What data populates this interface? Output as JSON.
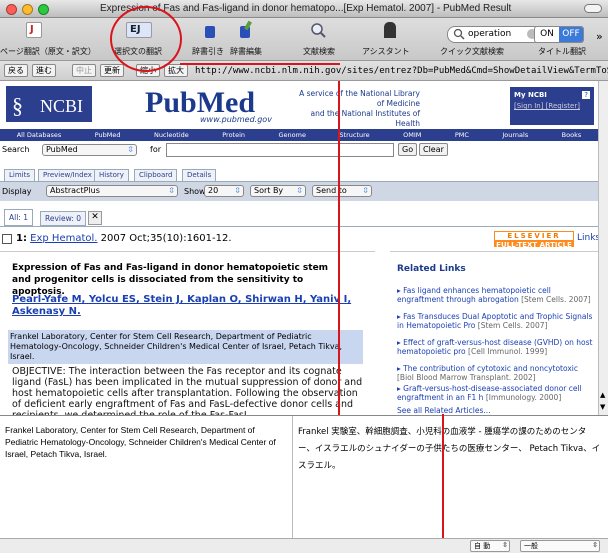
{
  "window": {
    "title": "Expression of Fas and Fas-ligand in donor hematopo...[Exp Hematol. 2007] - PubMed Result"
  },
  "toolbar": {
    "items": [
      {
        "label": "ページ翻訳（原文・訳文）",
        "icon": "page-translate-icon"
      },
      {
        "label": "選択文の翻訳",
        "icon": "selection-translate-icon",
        "icon_text": "EJ"
      },
      {
        "label": "辞書引き",
        "icon": "dictionary-lookup-icon"
      },
      {
        "label": "辞書編集",
        "icon": "dictionary-edit-icon"
      },
      {
        "label": "文献検索",
        "icon": "literature-search-icon"
      },
      {
        "label": "アシスタント",
        "icon": "assistant-icon"
      },
      {
        "label": "クイック文献検索",
        "icon": "quick-search-icon"
      },
      {
        "label": "タイトル翻訳",
        "icon": "title-translate-icon"
      }
    ],
    "search_value": "operation",
    "toggle_on": "ON",
    "toggle_off": "OFF",
    "more": "»"
  },
  "navbar": {
    "back": "戻る",
    "forward": "進む",
    "stop": "中止",
    "reload": "更新",
    "zoom_out": "縮小",
    "zoom_in": "拡大",
    "url": "http://www.ncbi.nlm.nih.gov/sites/entrez?Db=PubMed&Cmd=ShowDetailView&TermToSearch=17"
  },
  "banner": {
    "ncbi": "NCBI",
    "pubmed": "PubMed",
    "pubmed_sub": "www.pubmed.gov",
    "nlm_line1": "A service of the National Library of Medicine",
    "nlm_line2": "and the National Institutes of Health",
    "myncbi": "My NCBI",
    "myncbi_help": "?",
    "signin": "[Sign In] [Register]"
  },
  "dbbar": [
    "All Databases",
    "PubMed",
    "Nucleotide",
    "Protein",
    "Genome",
    "Structure",
    "OMIM",
    "PMC",
    "Journals",
    "Books"
  ],
  "search": {
    "label": "Search",
    "db": "PubMed",
    "for": "for",
    "go": "Go",
    "clear": "Clear"
  },
  "tabs": [
    "Limits",
    "Preview/Index",
    "History",
    "Clipboard",
    "Details"
  ],
  "display": {
    "label": "Display",
    "format": "AbstractPlus",
    "show": "Show",
    "count": "20",
    "sort": "Sort By",
    "send": "Send to"
  },
  "result_tabs": {
    "all": "All: 1",
    "review": "Review: 0"
  },
  "result": {
    "number": "1:",
    "journal": "Exp Hematol.",
    "citation": "2007 Oct;35(10):1601-12.",
    "elsevier": "ELSEVIER",
    "fulltext": "FULL-TEXT ARTICLE",
    "links": "Links",
    "title": "Expression of Fas and Fas-ligand in donor hematopoietic stem and progenitor cells is dissociated from the sensitivity to apoptosis.",
    "authors": "Pearl-Yafe M, Yolcu ES, Stein J, Kaplan O, Shirwan H, Yaniv I, Askenasy N.",
    "affiliation": "Frankel Laboratory, Center for Stem Cell Research, Department of Pediatric Hematology-Oncology, Schneider Children's Medical Center of Israel, Petach Tikva, Israel.",
    "abstract": "OBJECTIVE: The interaction between the Fas receptor and its cognate ligand (FasL) has been implicated in the mutual suppression of donor and host hematopoietic cells after transplantation. Following the observation of deficient early engraftment of Fas and FasL-defective donor cells and recipients, we determined the role of the Fas-FasL"
  },
  "related": {
    "heading": "Related Links",
    "items": [
      {
        "text": "Fas ligand enhances hematopoietic cell engraftment through abrogation",
        "src": "[Stem Cells. 2007]"
      },
      {
        "text": "Fas Transduces Dual Apoptotic and Trophic Signals in Hematopoietic Pro",
        "src": "[Stem Cells. 2007]"
      },
      {
        "text": "Effect of graft-versus-host disease (GVHD) on host hematopoietic pro",
        "src": "[Cell Immunol. 1999]"
      },
      {
        "text": "The contribution of cytotoxic and noncytotoxic",
        "src": "[Biol Blood Marrow Transplant. 2002]"
      },
      {
        "text": "Graft-versus-host-disease-associated donor cell engraftment in an F1 h",
        "src": "[Immunology. 2000]"
      }
    ],
    "see_all": "See all Related Articles..."
  },
  "translation": {
    "source": "Frankel Laboratory, Center for Stem Cell Research, Department of Pediatric Hematology-Oncology, Schneider Children's Medical Center of Israel, Petach Tikva, Israel.",
    "target": "Frankel 実験室、幹細胞調査、小児科の血液学 - 腫瘍学の課のためのセンター、イスラエルのシュナイダーの子供たちの医療センター、 Petach Tikva、イスラエル。"
  },
  "statusbar": {
    "mode": "自 動",
    "domain": "一般"
  },
  "colors": {
    "ncbi_blue": "#2c3f8f",
    "link": "#1a3fb3",
    "highlight": "#c8d6f0",
    "annotation_red": "#d8151b",
    "elsevier_orange": "#ff8a1e"
  }
}
